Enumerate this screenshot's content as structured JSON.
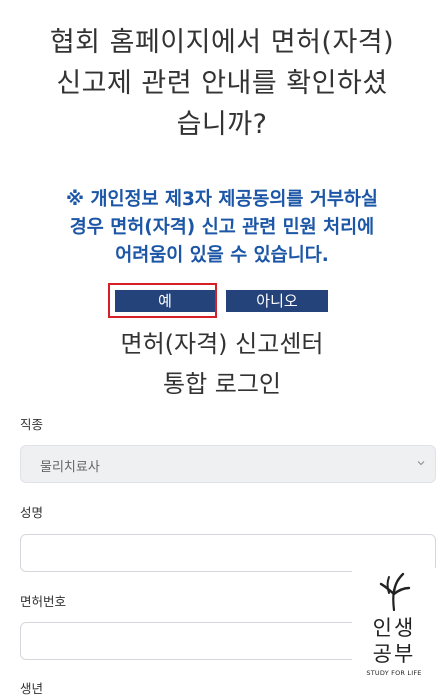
{
  "prompt": {
    "question_lines": [
      "협회 홈페이지에서 면허(자격)",
      "신고제 관련 안내를 확인하셨",
      "습니까?"
    ],
    "notice_lines": [
      "※ 개인정보 제3자 제공동의를 거부하실",
      "경우 면허(자격) 신고 관련 민원 처리에",
      "어려움이 있을 수 있습니다."
    ],
    "yes_label": "예",
    "no_label": "아니오"
  },
  "login": {
    "title_line1": "면허(자격) 신고센터",
    "title_line2": "통합 로그인",
    "job_label": "직종",
    "job_selected": "물리치료사",
    "name_label": "성명",
    "name_value": "",
    "license_label": "면허번호",
    "license_value": "",
    "extra_label": "생년"
  },
  "watermark": {
    "line1": "인생",
    "line2": "공부",
    "tagline": "STUDY FOR LIFE"
  },
  "colors": {
    "notice_text": "#1c56a6",
    "button_bg": "#24437b",
    "highlight_border": "#d61f26"
  },
  "icons": {
    "select_caret": "chevron-down-icon",
    "watermark_logo": "leaf-icon"
  }
}
